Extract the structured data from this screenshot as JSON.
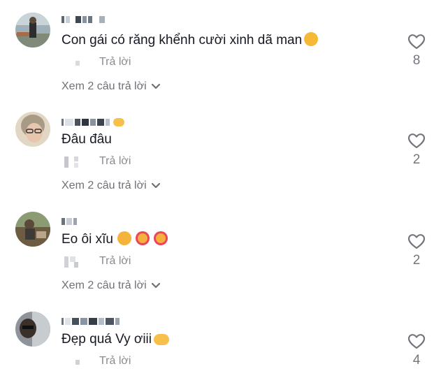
{
  "comments": [
    {
      "text": "Con gái có răng khểnh cười xinh dã man",
      "reply_label": "Trả lời",
      "likes": "8",
      "view_replies": "Xem 2 câu trả lời",
      "emoji": [
        "grinning-sweat-emoji"
      ]
    },
    {
      "text": "Đâu đâu",
      "reply_label": "Trả lời",
      "likes": "2",
      "view_replies": "Xem 2 câu trả lời"
    },
    {
      "text": "Eo ôi xĩu",
      "reply_label": "Trả lời",
      "likes": "2",
      "view_replies": "Xem 2 câu trả lời",
      "emoji": [
        "blushing-hand-emoji",
        "smiling-hearts-emoji",
        "smiling-hearts-emoji"
      ]
    },
    {
      "text": "Đẹp quá Vy ơiii",
      "reply_label": "Trả lời",
      "likes": "4",
      "emoji": [
        "heart-hands-emoji"
      ]
    }
  ],
  "colors": {
    "text": "#161823",
    "muted": "#8a8b91",
    "heart_outline": "#75767d"
  },
  "icons": {
    "like": "heart-outline-icon",
    "expand": "chevron-down-icon"
  }
}
